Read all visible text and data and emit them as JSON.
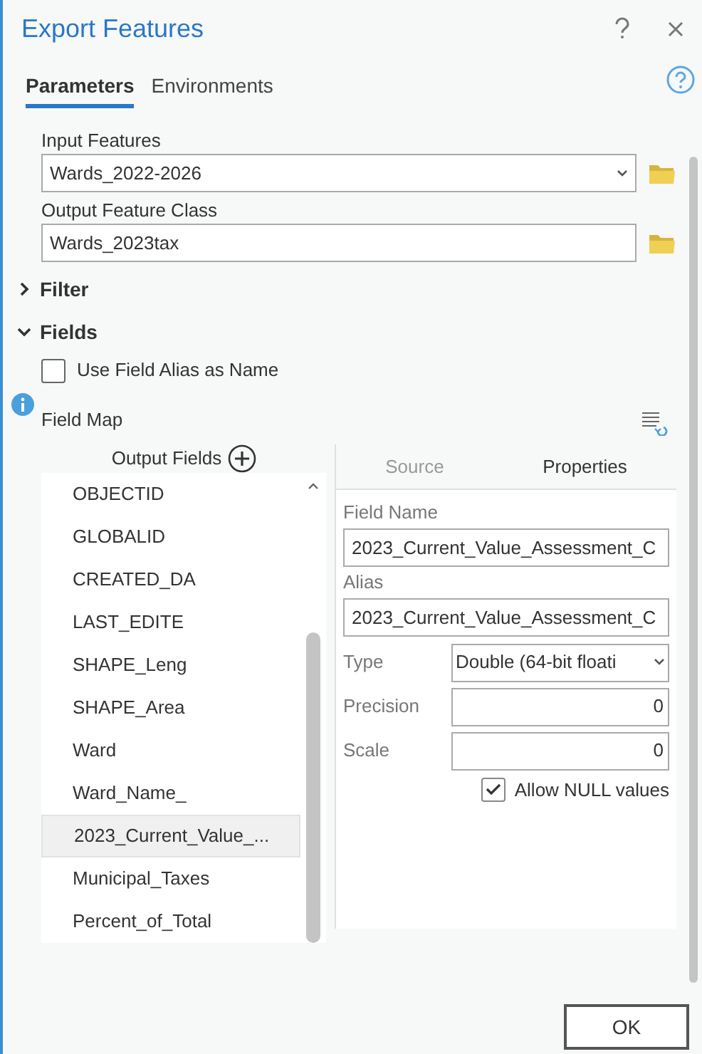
{
  "window": {
    "title": "Export Features"
  },
  "tabs": [
    {
      "label": "Parameters",
      "selected": true
    },
    {
      "label": "Environments",
      "selected": false
    }
  ],
  "input_features": {
    "label": "Input Features",
    "value": "Wards_2022-2026"
  },
  "output_feature_class": {
    "label": "Output Feature Class",
    "value": "Wards_2023tax"
  },
  "sections": [
    {
      "label": "Filter",
      "expanded": false
    },
    {
      "label": "Fields",
      "expanded": true
    }
  ],
  "use_field_alias": {
    "label": "Use Field Alias as Name",
    "checked": false
  },
  "field_map": {
    "label": "Field Map"
  },
  "output_fields": {
    "header": "Output Fields",
    "items": [
      {
        "label": "OBJECTID",
        "selected": false
      },
      {
        "label": "GLOBALID",
        "selected": false
      },
      {
        "label": "CREATED_DA",
        "selected": false
      },
      {
        "label": "LAST_EDITE",
        "selected": false
      },
      {
        "label": "SHAPE_Leng",
        "selected": false
      },
      {
        "label": "SHAPE_Area",
        "selected": false
      },
      {
        "label": "Ward",
        "selected": false
      },
      {
        "label": "Ward_Name_",
        "selected": false
      },
      {
        "label": "2023_Current_Value_...",
        "selected": true
      },
      {
        "label": "Municipal_Taxes",
        "selected": false
      },
      {
        "label": "Percent_of_Total",
        "selected": false
      }
    ]
  },
  "property_tabs": [
    {
      "label": "Source",
      "selected": false
    },
    {
      "label": "Properties",
      "selected": true
    }
  ],
  "properties": {
    "field_name": {
      "label": "Field Name",
      "value": "2023_Current_Value_Assessment_C"
    },
    "alias": {
      "label": "Alias",
      "value": "2023_Current_Value_Assessment_C"
    },
    "type": {
      "label": "Type",
      "value": "Double (64-bit floati"
    },
    "precision": {
      "label": "Precision",
      "value": "0"
    },
    "scale": {
      "label": "Scale",
      "value": "0"
    },
    "allow_null": {
      "label": "Allow NULL values",
      "checked": true
    }
  },
  "ok_button": "OK"
}
